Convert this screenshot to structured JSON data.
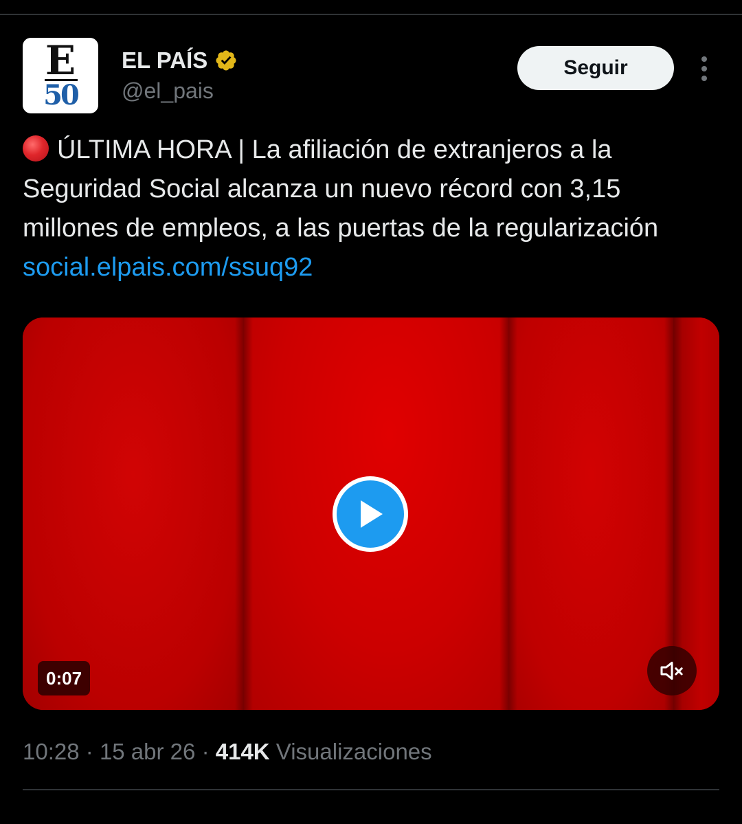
{
  "tweet": {
    "author": {
      "name": "EL PAÍS",
      "handle": "@el_pais",
      "avatar_logo_letter": "E",
      "avatar_logo_number": "50",
      "verified_color": "#e2b719"
    },
    "follow_label": "Seguir",
    "text_main": "ÚLTIMA HORA | La afiliación de extranjeros a la Seguridad Social alcanza un nuevo récord con 3,15 millones de empleos, a las puertas de la regularización",
    "link": "social.elpais.com/ssuq92",
    "video": {
      "duration": "0:07",
      "muted": true
    },
    "meta": {
      "time": "10:28",
      "date": "15 abr 26",
      "views_count": "414K",
      "views_label": "Visualizaciones",
      "separator": "·"
    }
  },
  "colors": {
    "background": "#000000",
    "text": "#e7e9ea",
    "muted_text": "#71767b",
    "link": "#1d9bf0",
    "play_button": "#1d9bf0",
    "video_red": "#cc0000"
  }
}
